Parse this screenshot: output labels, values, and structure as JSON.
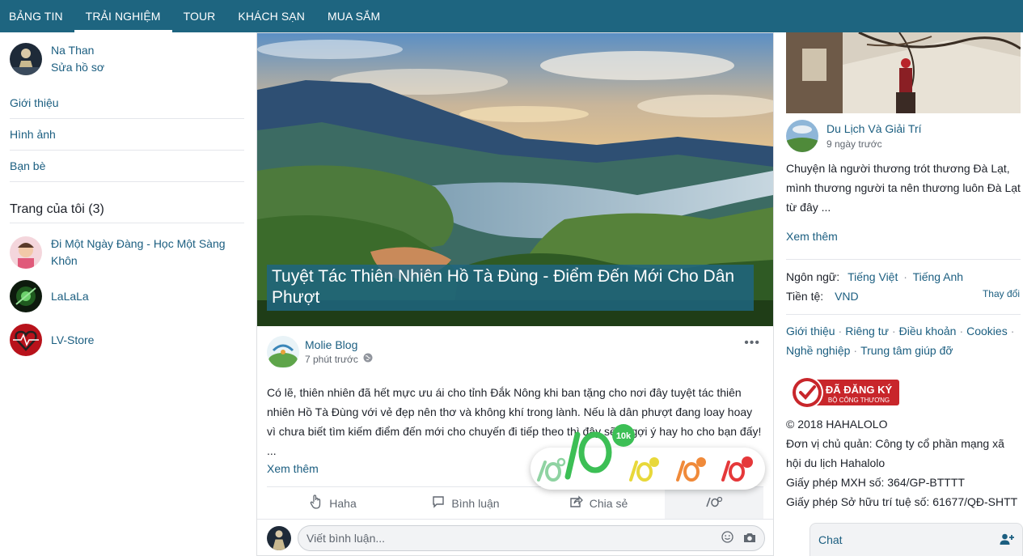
{
  "nav": {
    "tabs": [
      "BẢNG TIN",
      "TRẢI NGHIỆM",
      "TOUR",
      "KHÁCH SẠN",
      "MUA SẮM"
    ],
    "active_index": 1
  },
  "left": {
    "user_name": "Na Than",
    "edit_profile": "Sửa hồ sơ",
    "menu": [
      "Giới thiệu",
      "Hình ảnh",
      "Bạn bè"
    ],
    "my_pages_title": "Trang của tôi (3)",
    "pages": [
      "Đi Một Ngày Đàng - Học Một Sàng Khôn",
      "LaLaLa",
      "LV-Store"
    ]
  },
  "post": {
    "title": "Tuyệt Tác Thiên Nhiên Hồ Tà Đùng - Điểm Đến Mới Cho Dân Phượt",
    "author": "Molie Blog",
    "time": "7 phút trước",
    "more_dots": "•••",
    "text": "Có lẽ, thiên nhiên đã hết mực ưu ái cho tỉnh Đắk Nông khi ban tặng cho nơi đây tuyệt tác thiên nhiên Hồ Tà Đùng với vẻ đẹp nên thơ và không khí trong lành. Nếu là dân phượt đang loay hoay vì chưa biết tìm kiếm điểm đến mới cho chuyến đi tiếp theo thì đây sẽ là gợi ý hay ho cho bạn đấy!",
    "ellipsis": "...",
    "see_more": "Xem thêm",
    "actions": [
      "Haha",
      "Bình luận",
      "Chia sẻ"
    ],
    "comment_placeholder": "Viết bình luận...",
    "reaction_badge": "10k"
  },
  "right": {
    "author": "Du Lịch Và Giải Trí",
    "time": "9 ngày trước",
    "text": "Chuyện là người thương trót thương Đà Lạt, mình thương người ta nên thương luôn Đà Lạt từ đây ...",
    "see_more": "Xem thêm",
    "language_label": "Ngôn ngữ:",
    "lang_vi": "Tiếng Việt",
    "lang_en": "Tiếng Anh",
    "currency_label": "Tiền tệ:",
    "currency": "VND",
    "change": "Thay đổi",
    "links": [
      "Giới thiệu",
      "Riêng tư",
      "Điều khoản",
      "Cookies",
      "Nghề nghiệp",
      "Trung tâm giúp đỡ"
    ],
    "badge_main": "ĐÃ ĐĂNG KÝ",
    "badge_sub": "BỘ CÔNG THƯƠNG",
    "copyright": "© 2018 HAHALOLO",
    "owner": "Đơn vị chủ quản: Công ty cổ phần mạng xã hội du lịch Hahalolo",
    "license1": "Giấy phép MXH số: 364/GP-BTTTT",
    "license2": "Giấy phép Sở hữu trí tuệ số: 61677/QĐ-SHTT"
  },
  "chat": {
    "label": "Chat"
  },
  "colors": {
    "brand": "#1e6580",
    "link": "#1b5e80",
    "muted": "#606770"
  }
}
